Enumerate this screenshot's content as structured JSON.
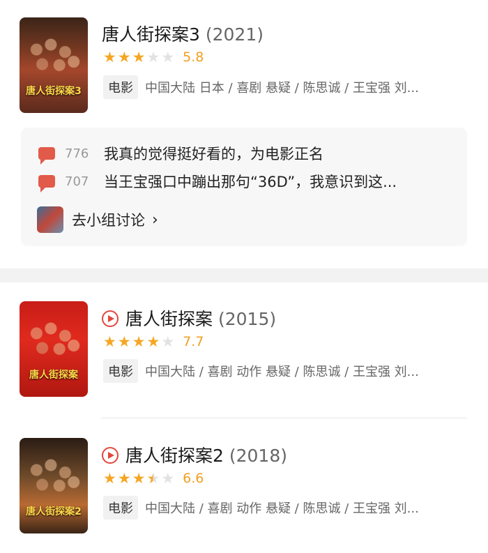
{
  "items": [
    {
      "title": "唐人街探案3",
      "year": "(2021)",
      "rating": "5.8",
      "stars": [
        1,
        1,
        1,
        0,
        0
      ],
      "type_badge": "电影",
      "meta": "中国大陆 日本 / 喜剧 悬疑 / 陈思诚 / 王宝强 刘...",
      "poster_text": "唐人街探案3"
    },
    {
      "title": "唐人街探案",
      "year": "(2015)",
      "rating": "7.7",
      "stars": [
        1,
        1,
        1,
        1,
        0
      ],
      "type_badge": "电影",
      "meta": "中国大陆 / 喜剧 动作 悬疑 / 陈思诚 / 王宝强 刘...",
      "poster_text": "唐人街探案"
    },
    {
      "title": "唐人街探案2",
      "year": "(2018)",
      "rating": "6.6",
      "stars": [
        1,
        1,
        1,
        0.5,
        0
      ],
      "type_badge": "电影",
      "meta": "中国大陆 / 喜剧 动作 悬疑 / 陈思诚 / 王宝强 刘...",
      "poster_text": "唐人街探案2"
    }
  ],
  "comments": [
    {
      "count": "776",
      "text": "我真的觉得挺好看的，为电影正名"
    },
    {
      "count": "707",
      "text": "当王宝强口中蹦出那句“36D”，我意识到这..."
    }
  ],
  "group_link": {
    "label": "去小组讨论"
  },
  "icons": {
    "comment": "comment-bubble-icon",
    "play": "play-circle-icon",
    "chevron": "chevron-right-icon",
    "star": "star-icon"
  },
  "colors": {
    "star": "#f5a623",
    "rating": "#f0a021",
    "accent_red": "#e3463b"
  }
}
